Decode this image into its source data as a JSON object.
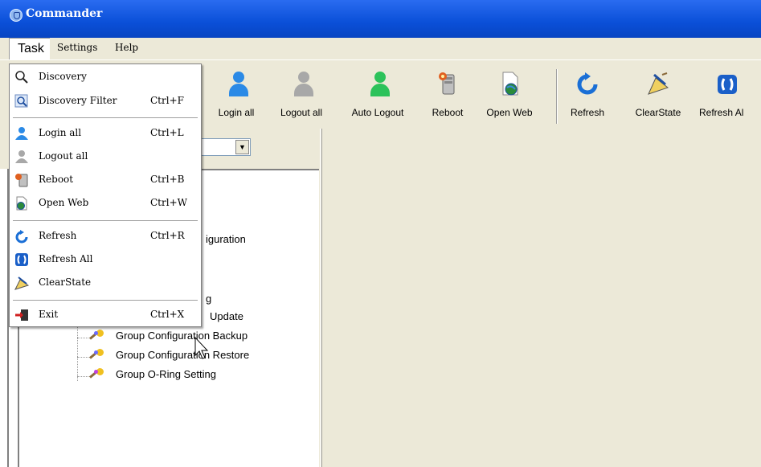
{
  "window": {
    "title": "Commander"
  },
  "menubar": {
    "task": "Task",
    "settings": "Settings",
    "help": "Help"
  },
  "toolbar": {
    "login_all": "Login all",
    "logout_all": "Logout all",
    "auto_logout": "Auto Logout",
    "reboot": "Reboot",
    "open_web": "Open Web",
    "refresh": "Refresh",
    "clearstate": "ClearState",
    "refresh_all": "Refresh Al"
  },
  "task_menu": {
    "discovery": "Discovery",
    "discovery_filter": "Discovery Filter",
    "discovery_filter_sc": "Ctrl+F",
    "login_all": "Login all",
    "login_all_sc": "Ctrl+L",
    "logout_all": "Logout all",
    "reboot": "Reboot",
    "reboot_sc": "Ctrl+B",
    "open_web": "Open Web",
    "open_web_sc": "Ctrl+W",
    "refresh": "Refresh",
    "refresh_sc": "Ctrl+R",
    "refresh_all": "Refresh All",
    "clearstate": "ClearState",
    "exit": "Exit",
    "exit_sc": "Ctrl+X"
  },
  "tree": {
    "partial_configuration": "iguration",
    "partial_g": "g",
    "partial_update": "Update",
    "group_config_backup": "Group Configuration Backup",
    "group_config_restore": "Group Configuration Restore",
    "group_oring_setting": "Group O-Ring Setting"
  },
  "colors": {
    "titlebar": "#0a4fd8",
    "face": "#ece9d8",
    "login_blue": "#2b8ae6",
    "logout_gray": "#a8a8a8",
    "auto_green": "#2cc25a"
  }
}
